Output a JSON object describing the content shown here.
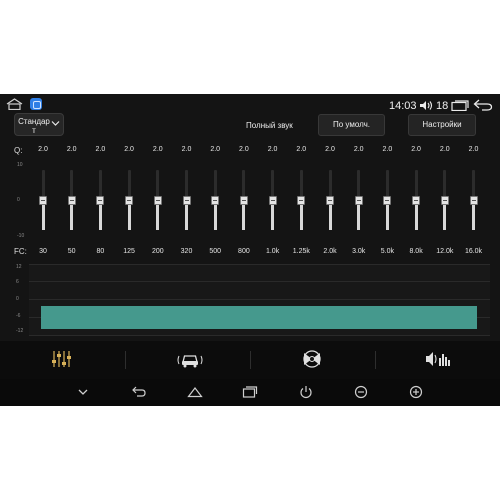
{
  "status": {
    "time": "14:03",
    "volume": "18"
  },
  "header": {
    "preset_label": "Стандарт",
    "mode_label": "Полный звук",
    "default_button": "По умолч.",
    "settings_button": "Настройки"
  },
  "eq": {
    "q_label": "Q:",
    "fc_label": "FC:",
    "scale_labels": [
      "10",
      "0",
      "-10"
    ],
    "frequencies": [
      "30",
      "50",
      "80",
      "125",
      "200",
      "320",
      "500",
      "800",
      "1.0k",
      "1.25k",
      "2.0k",
      "3.0k",
      "5.0k",
      "8.0k",
      "12.0k",
      "16.0k"
    ],
    "q_values": [
      "2.0",
      "2.0",
      "2.0",
      "2.0",
      "2.0",
      "2.0",
      "2.0",
      "2.0",
      "2.0",
      "2.0",
      "2.0",
      "2.0",
      "2.0",
      "2.0",
      "2.0",
      "2.0"
    ],
    "gains_db": [
      0,
      0,
      0,
      0,
      0,
      0,
      0,
      0,
      0,
      0,
      0,
      0,
      0,
      0,
      0,
      0
    ],
    "graph_labels": [
      "12",
      "6",
      "0",
      "-6",
      "-12"
    ],
    "curve_color": "#45998d"
  },
  "tabs": [
    {
      "name": "equalizer",
      "icon": "equalizer-icon",
      "active": true
    },
    {
      "name": "car-position",
      "icon": "car-sound-icon",
      "active": false
    },
    {
      "name": "balance",
      "icon": "speaker-balance-icon",
      "active": false
    },
    {
      "name": "sound-effects",
      "icon": "sound-effects-icon",
      "active": false
    }
  ],
  "colors": {
    "accent": "#d9b25a",
    "curve": "#45998d",
    "background": "#141414"
  }
}
